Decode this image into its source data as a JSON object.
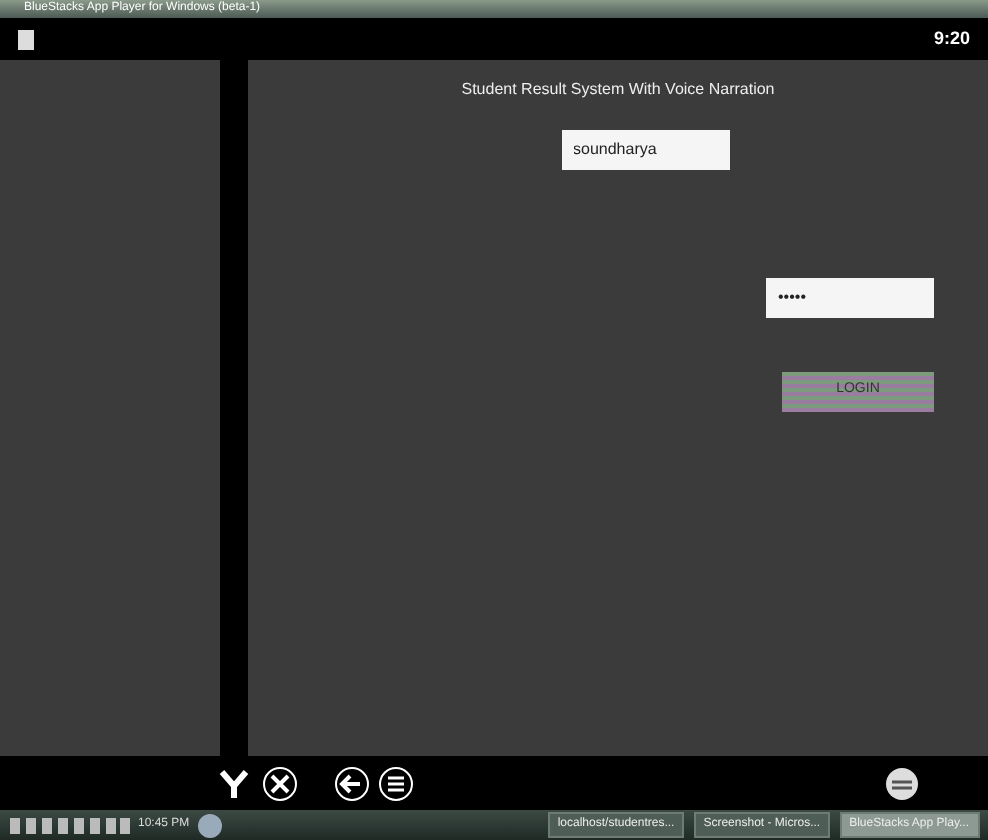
{
  "window": {
    "title": "BlueStacks App Player for Windows (beta-1)"
  },
  "status_bar": {
    "time": "9:20"
  },
  "app": {
    "heading": "Student Result System With Voice Narration",
    "username": {
      "value": "soundharya"
    },
    "password": {
      "value": "•••••"
    },
    "login_button": "LOGIN"
  },
  "taskbar": {
    "clock": "10:45 PM",
    "tasks": [
      {
        "label": "localhost/studentres...",
        "selected": false
      },
      {
        "label": "Screenshot - Micros...",
        "selected": false
      },
      {
        "label": "BlueStacks App Play...",
        "selected": true
      }
    ]
  }
}
